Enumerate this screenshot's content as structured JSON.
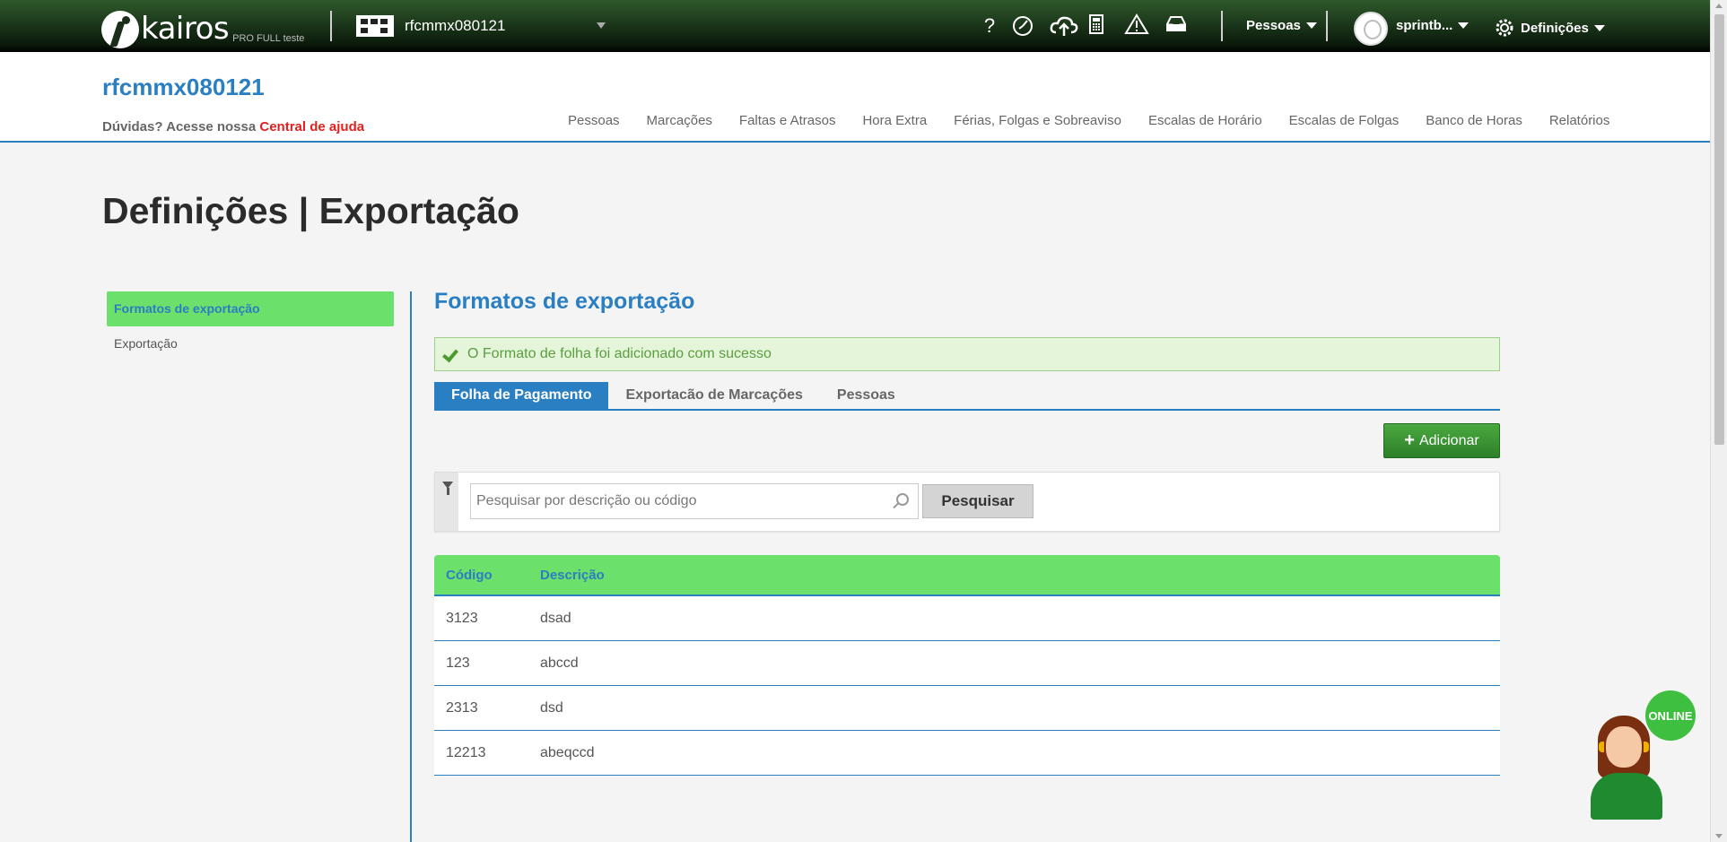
{
  "topbar": {
    "logo_text": "kairos",
    "logo_sub": "PRO FULL teste",
    "company": "rfcmmx080121",
    "icons": [
      "help-icon",
      "clock-icon",
      "cloud-upload-icon",
      "calculator-icon",
      "warning-icon",
      "inbox-icon"
    ],
    "people_menu": "Pessoas",
    "user_menu": "sprintb...",
    "settings_menu": "Definições"
  },
  "header": {
    "company_title": "rfcmmx080121",
    "help_prefix": "Dúvidas? Acesse nossa",
    "help_link": "Central de ajuda",
    "nav": [
      "Pessoas",
      "Marcações",
      "Faltas e Atrasos",
      "Hora Extra",
      "Férias, Folgas e Sobreaviso",
      "Escalas de Horário",
      "Escalas de Folgas",
      "Banco de Horas",
      "Relatórios"
    ]
  },
  "page": {
    "title": "Definições | Exportação"
  },
  "sidebar": {
    "items": [
      {
        "label": "Formatos de exportação",
        "active": true
      },
      {
        "label": "Exportação",
        "active": false
      }
    ]
  },
  "main": {
    "section_title": "Formatos de exportação",
    "alert": "O Formato de folha foi adicionado com sucesso",
    "tabs": [
      {
        "label": "Folha de Pagamento",
        "active": true
      },
      {
        "label": "Exportacão de Marcações",
        "active": false
      },
      {
        "label": "Pessoas",
        "active": false
      }
    ],
    "add_button": "Adicionar",
    "search": {
      "placeholder": "Pesquisar por descrição ou código",
      "value": "",
      "button": "Pesquisar"
    },
    "table": {
      "headers": [
        "Código",
        "Descrição"
      ],
      "rows": [
        [
          "3123",
          "dsad"
        ],
        [
          "123",
          "abccd"
        ],
        [
          "2313",
          "dsd"
        ],
        [
          "12213",
          "abeqccd"
        ]
      ]
    }
  },
  "chat": {
    "status": "ONLINE"
  },
  "colors": {
    "accent_blue": "#2a7fc3",
    "success_green": "#6be06a",
    "button_green": "#2d7f28",
    "help_link_red": "#e32020"
  }
}
